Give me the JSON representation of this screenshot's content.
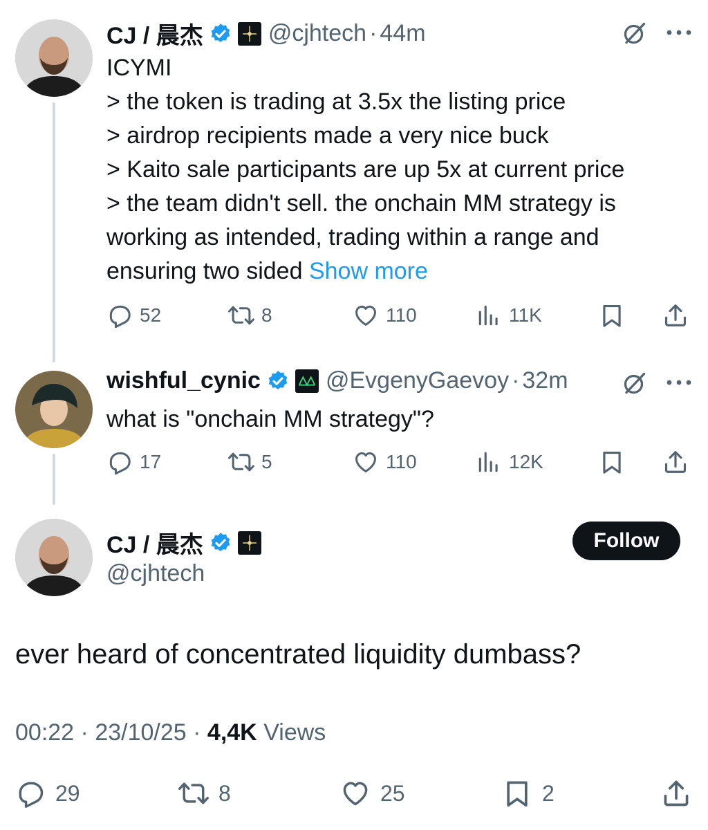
{
  "tweet1": {
    "name": "CJ / 晨杰",
    "handle": "@cjhtech",
    "dot": "·",
    "time": "44m",
    "lines": [
      "ICYMI",
      "> the token is trading at 3.5x the listing price",
      "> airdrop recipients made a very nice buck",
      "> Kaito sale participants are up 5x at current price",
      "> the team didn't sell. the onchain MM strategy is",
      "working as intended, trading within a range and",
      "ensuring two sided "
    ],
    "show_more": "Show more",
    "replies": "52",
    "reposts": "8",
    "likes": "110",
    "views": "11K"
  },
  "tweet2": {
    "name": "wishful_cynic",
    "handle": "@EvgenyGaevoy",
    "dot": "·",
    "time": "32m",
    "text": "what is \"onchain MM strategy\"?",
    "replies": "17",
    "reposts": "5",
    "likes": "110",
    "views": "12K"
  },
  "main": {
    "name": "CJ / 晨杰",
    "handle": "@cjhtech",
    "follow_label": "Follow",
    "text": "ever heard of concentrated liquidity dumbass?",
    "time": "00:22",
    "dot": "·",
    "date": "23/10/25",
    "views_count": "4,4K",
    "views_label": "Views",
    "replies": "29",
    "reposts": "8",
    "likes": "25",
    "bookmarks": "2"
  },
  "colors": {
    "accent": "#1d9bf0",
    "text": "#0f1419",
    "muted": "#536471",
    "follow_bg": "#0f1419"
  },
  "icons": [
    "verified-badge-icon",
    "affiliate-logo-icon",
    "grok-icon",
    "more-icon",
    "reply-icon",
    "repost-icon",
    "like-icon",
    "views-icon",
    "bookmark-icon",
    "share-icon"
  ]
}
